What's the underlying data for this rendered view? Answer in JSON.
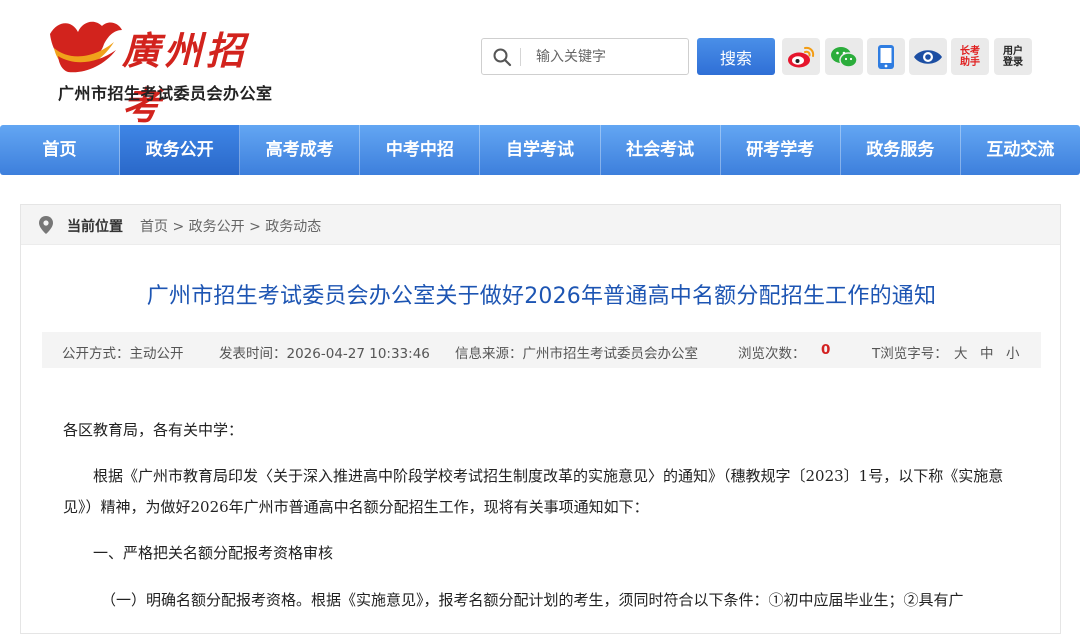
{
  "header": {
    "logo_title": "廣州招考",
    "logo_subtitle": "广州市招生考试委员会办公室",
    "search_placeholder": "输入关键字",
    "search_button": "搜索",
    "social": [
      {
        "name": "weibo",
        "label": ""
      },
      {
        "name": "wechat",
        "label": ""
      },
      {
        "name": "mobile",
        "label": ""
      },
      {
        "name": "eye",
        "label": ""
      }
    ],
    "assistant_line1": "长考",
    "assistant_line2": "助手",
    "user_line1": "用户",
    "user_line2": "登录"
  },
  "nav": {
    "items": [
      "首页",
      "政务公开",
      "高考成考",
      "中考中招",
      "自学考试",
      "社会考试",
      "研考学考",
      "政务服务",
      "互动交流"
    ],
    "active_index": 1
  },
  "breadcrumb": {
    "label": "当前位置",
    "path": [
      "首页",
      "政务公开",
      "政务动态"
    ],
    "separator": ">"
  },
  "article": {
    "title": "广州市招生考试委员会办公室关于做好2026年普通高中名额分配招生工作的通知",
    "meta": {
      "open_mode": "公开方式：主动公开",
      "publish_time": "发表时间：2026-04-27 10:33:46",
      "source": "信息来源：广州市招生考试委员会办公室",
      "views_label": "浏览次数：",
      "views_count": "0",
      "font_label": "T浏览字号：",
      "font_large": "大",
      "font_medium": "中",
      "font_small": "小"
    },
    "paragraphs": {
      "greeting": "各区教育局，各有关中学：",
      "intro": "根据《广州市教育局印发〈关于深入推进高中阶段学校考试招生制度改革的实施意见〉的通知》（穗教规字〔2023〕1号，以下称《实施意见》）精神，为做好2026年广州市普通高中名额分配招生工作，现将有关事项通知如下：",
      "section1": "一、严格把关名额分配报考资格审核",
      "section1_1": "（一）明确名额分配报考资格。根据《实施意见》，报考名额分配计划的考生，须同时符合以下条件：①初中应届毕业生；②具有广"
    }
  },
  "colors": {
    "nav_blue": "#4a8fe8",
    "title_blue": "#1d55b3",
    "logo_red": "#d2231d",
    "count_red": "#d32121"
  }
}
